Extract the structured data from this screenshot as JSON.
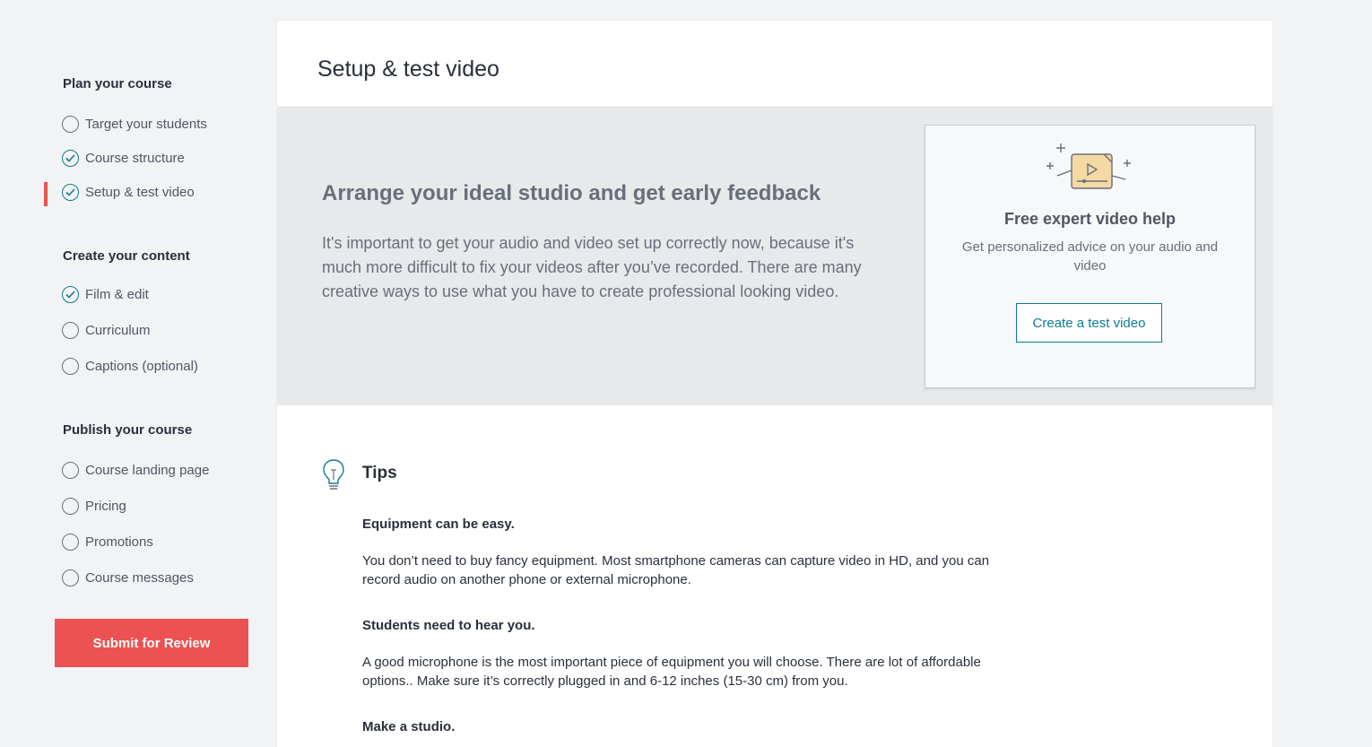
{
  "sidebar": {
    "sections": [
      {
        "title": "Plan your course",
        "items": [
          {
            "label": "Target your students",
            "done": false
          },
          {
            "label": "Course structure",
            "done": true
          },
          {
            "label": "Setup & test video",
            "done": true,
            "active": true
          }
        ]
      },
      {
        "title": "Create your content",
        "items": [
          {
            "label": "Film & edit",
            "done": true
          },
          {
            "label": "Curriculum",
            "done": false
          },
          {
            "label": "Captions (optional)",
            "done": false
          }
        ]
      },
      {
        "title": "Publish your course",
        "items": [
          {
            "label": "Course landing page",
            "done": false
          },
          {
            "label": "Pricing",
            "done": false
          },
          {
            "label": "Promotions",
            "done": false
          },
          {
            "label": "Course messages",
            "done": false
          }
        ]
      }
    ],
    "submit_label": "Submit for Review"
  },
  "main": {
    "title": "Setup & test video",
    "hero": {
      "title": "Arrange your ideal studio and get early feedback",
      "text": "It's important to get your audio and video set up correctly now, because it's much more difficult to fix your videos after you’ve recorded. There are many creative ways to use what you have to create professional looking video."
    },
    "help_card": {
      "icon": "video-help-icon",
      "title": "Free expert video help",
      "text": "Get personalized advice on your audio and video",
      "button_label": "Create a test video"
    },
    "tips": {
      "icon": "lightbulb-icon",
      "title": "Tips",
      "items": [
        {
          "heading": "Equipment can be easy.",
          "body": "You don’t need to buy fancy equipment. Most smartphone cameras can capture video in HD, and you can record audio on another phone or external microphone."
        },
        {
          "heading": "Students need to hear you.",
          "body": "A good microphone is the most important piece of equipment you will choose. There are lot of affordable options.. Make sure it’s correctly plugged in and 6-12 inches (15-30 cm) from you."
        },
        {
          "heading": "Make a studio.",
          "body": ""
        }
      ]
    }
  },
  "colors": {
    "accent": "#ec5252",
    "teal": "#0f7c90",
    "background": "#f2f3f5"
  }
}
